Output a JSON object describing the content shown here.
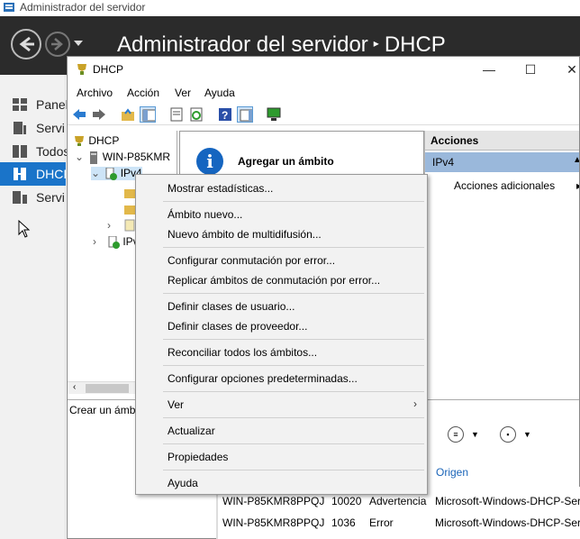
{
  "server_manager": {
    "window_title": "Administrador del servidor",
    "header_title": "Administrador del servidor",
    "header_section": "DHCP",
    "sidebar": [
      {
        "label": "Panel"
      },
      {
        "label": "Servi"
      },
      {
        "label": "Todos"
      },
      {
        "label": "DHCP"
      },
      {
        "label": "Servi"
      }
    ]
  },
  "dhcp_window": {
    "title": "DHCP",
    "menu": [
      "Archivo",
      "Acción",
      "Ver",
      "Ayuda"
    ],
    "tree": {
      "root": "DHCP",
      "server": "WIN-P85KMR",
      "ipv4": "IPv4",
      "ipv6": "IPv"
    },
    "center": {
      "add_scope": "Agregar un ámbito"
    },
    "actions": {
      "header": "Acciones",
      "section": "IPv4",
      "more": "Acciones adicionales"
    },
    "status_text": "Crear un ámbi"
  },
  "context_menu": {
    "items": [
      {
        "label": "Mostrar estadísticas..."
      },
      {
        "label": "Ámbito nuevo..."
      },
      {
        "label": "Nuevo ámbito de multidifusión..."
      },
      {
        "label": "Configurar conmutación por error..."
      },
      {
        "label": "Replicar ámbitos de conmutación por error..."
      },
      {
        "label": "Definir clases de usuario..."
      },
      {
        "label": "Definir clases de proveedor..."
      },
      {
        "label": "Reconciliar todos los ámbitos..."
      },
      {
        "label": "Configurar opciones predeterminadas..."
      },
      {
        "label": "Ver"
      },
      {
        "label": "Actualizar"
      },
      {
        "label": "Propiedades"
      },
      {
        "label": "Ayuda"
      }
    ]
  },
  "events": {
    "column_origin": "Origen",
    "rows": [
      {
        "server": "WIN-P85KMR8PPQJ",
        "id": "10020",
        "level": "Advertencia",
        "source": "Microsoft-Windows-DHCP-Ser"
      },
      {
        "server": "WIN-P85KMR8PPQJ",
        "id": "1036",
        "level": "Error",
        "source": "Microsoft-Windows-DHCP-Ser"
      }
    ]
  },
  "colors": {
    "header_bg": "#2b2b2b",
    "selected_blue": "#1a74c9",
    "actions_highlight": "#9ab8db"
  }
}
